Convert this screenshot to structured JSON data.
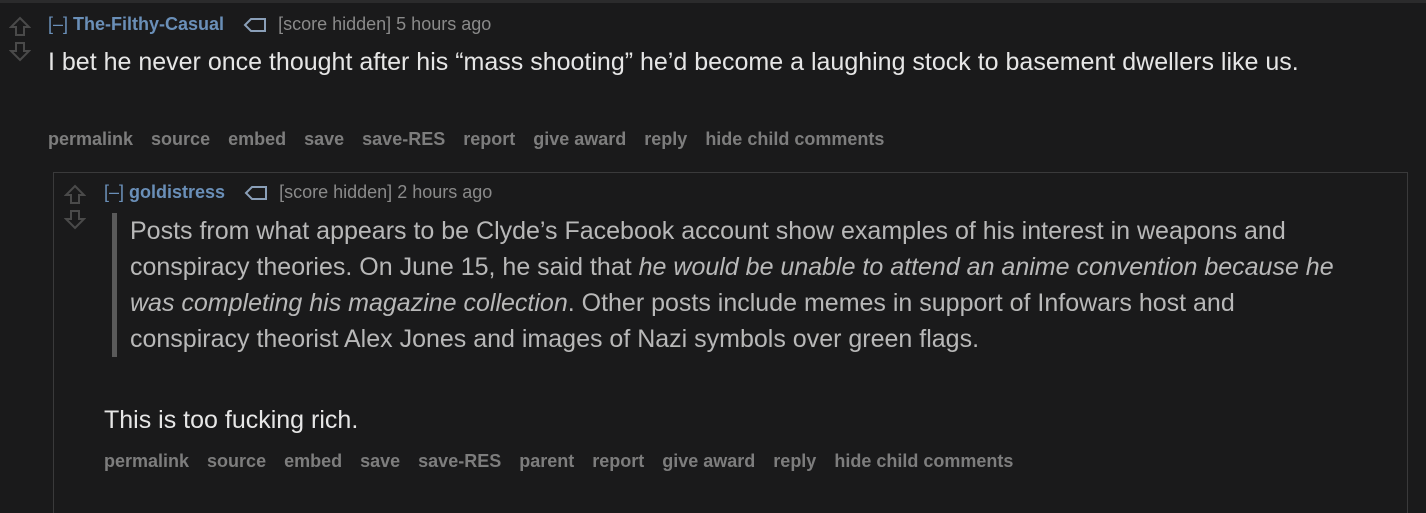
{
  "comments": [
    {
      "collapse": "[–]",
      "author": "The-Filthy-Casual",
      "score": "[score hidden]",
      "time": "5 hours ago",
      "body": "I bet he never once thought after his “mass shooting” he’d become a laughing stock to basement dwellers like us.",
      "actions": [
        "permalink",
        "source",
        "embed",
        "save",
        "save-RES",
        "report",
        "give award",
        "reply",
        "hide child comments"
      ]
    },
    {
      "collapse": "[–]",
      "author": "goldistress",
      "score": "[score hidden]",
      "time": "2 hours ago",
      "quote": {
        "part1": "Posts from what appears to be Clyde’s Facebook account show examples of his interest in weapons and conspiracy theories. On June 15, he said that ",
        "italic": "he would be unable to attend an anime convention because he was completing his magazine collection",
        "part2": ". Other posts include memes in support of Infowars host and conspiracy theorist Alex Jones and images of Nazi symbols over green flags."
      },
      "body": "This is too fucking rich.",
      "actions": [
        "permalink",
        "source",
        "embed",
        "save",
        "save-RES",
        "parent",
        "report",
        "give award",
        "reply",
        "hide child comments"
      ]
    }
  ],
  "colors": {
    "background": "#1a1a1b",
    "author": "#6a8fb8",
    "text": "#e6e6e6",
    "muted": "#7d7d7d"
  },
  "icons": [
    "upvote-arrow-icon",
    "downvote-arrow-icon",
    "user-tag-icon"
  ]
}
